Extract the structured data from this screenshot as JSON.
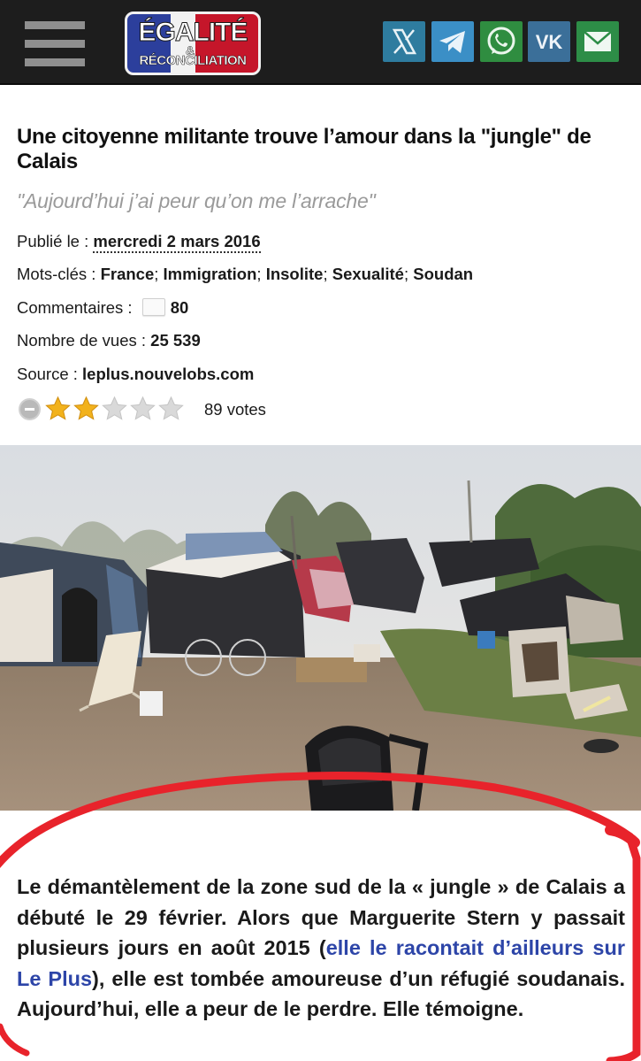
{
  "header": {
    "logo_line1": "ÉGALITÉ",
    "logo_amp": "&",
    "logo_line2": "RÉCONCILIATION",
    "menu_icon": "hamburger-menu-icon",
    "share": [
      {
        "name": "x",
        "icon": "x-twitter-icon",
        "color": "#2e7c9f"
      },
      {
        "name": "telegram",
        "icon": "telegram-icon",
        "color": "#3b8fc6"
      },
      {
        "name": "whatsapp",
        "icon": "whatsapp-icon",
        "color": "#2f8d40"
      },
      {
        "name": "vk",
        "icon": "vk-icon",
        "color": "#3b6f99"
      },
      {
        "name": "email",
        "icon": "mail-icon",
        "color": "#2d8d47"
      }
    ]
  },
  "article": {
    "title": "Une citoyenne militante trouve l’amour dans la \"jungle\" de Calais",
    "subtitle": "\"Aujourd’hui j’ai peur qu’on me l’arrache\"",
    "published_label": "Publié le : ",
    "published_date": "mercredi 2 mars 2016",
    "tags_label": "Mots-clés : ",
    "tags": [
      "France",
      "Immigration",
      "Insolite",
      "Sexualité",
      "Soudan"
    ],
    "tag_separator": "; ",
    "comments_label": "Commentaires : ",
    "comments_count": "80",
    "views_label": "Nombre de vues : ",
    "views_count": "25 539",
    "source_label": "Source : ",
    "source": "leplus.nouvelobs.com",
    "rating": {
      "filled_stars": 2,
      "max_stars": 5,
      "votes_text": "89 votes"
    },
    "lead_before_link": "Le démantèlement de la zone sud de la « jungle » de Calais a débuté le 29 février. Alors que Marguerite Stern y passait plusieurs jours en août 2015 (",
    "lead_link": "elle le racontait d’ailleurs sur Le Plus",
    "lead_after_link": "), elle est tombée amoureuse d’un réfugié soudanais. Aujourd’hui, elle a peur de le perdre. Elle témoigne."
  },
  "colors": {
    "topbar": "#1d1d1d",
    "link": "#2d45a8",
    "subtitle": "#9a9a9a",
    "star_filled": "#f2b21c",
    "star_empty": "#d9d9d9",
    "annotation": "#e8232b"
  }
}
